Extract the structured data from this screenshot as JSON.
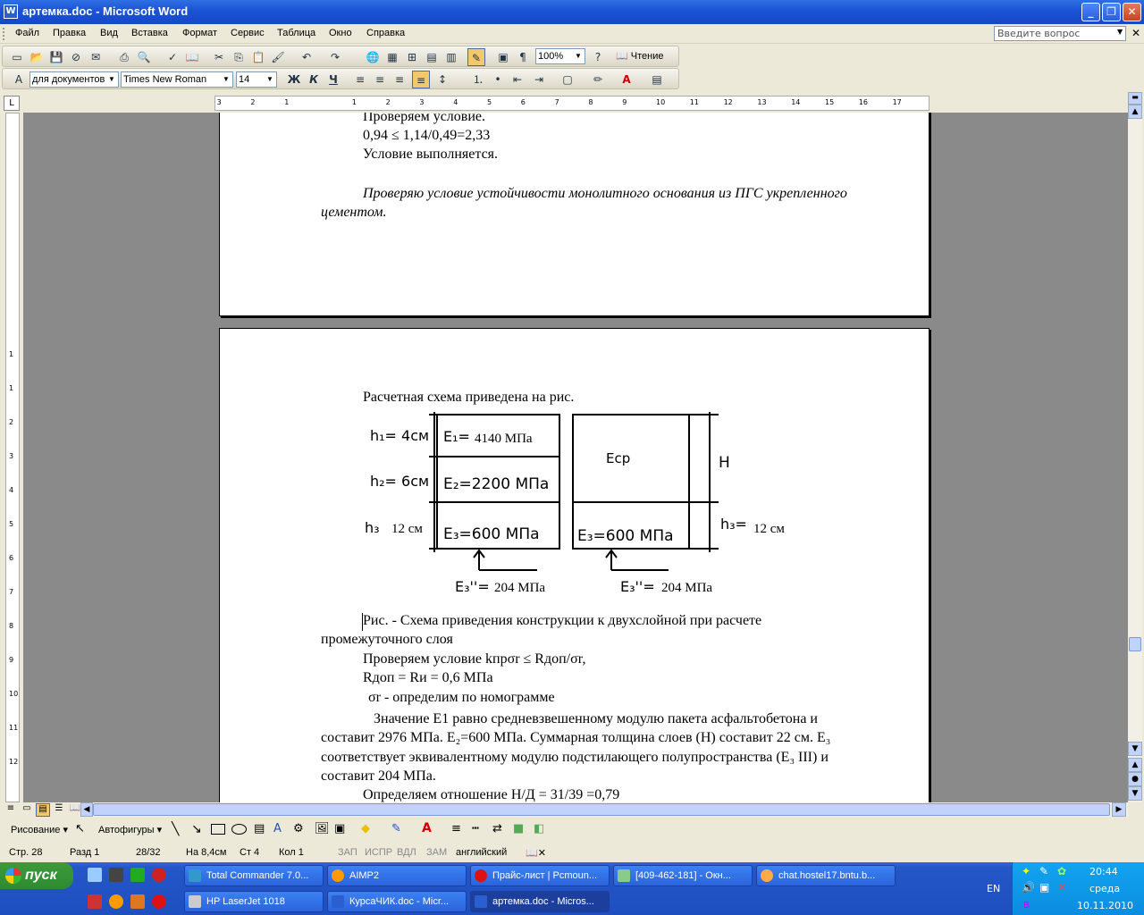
{
  "window": {
    "title": "артемка.doc - Microsoft Word",
    "icon": "W"
  },
  "menu": [
    "Файл",
    "Правка",
    "Вид",
    "Вставка",
    "Формат",
    "Сервис",
    "Таблица",
    "Окно",
    "Справка"
  ],
  "ask_placeholder": "Введите вопрос",
  "toolbar": {
    "zoom": "100%",
    "reading_label": "Чтение",
    "style": "для документов",
    "font": "Times New Roman",
    "size": "14",
    "bold": "Ж",
    "italic": "К",
    "underline": "Ч"
  },
  "ruler": {
    "h_labels": [
      "3",
      "2",
      "1",
      "1",
      "2",
      "3",
      "4",
      "5",
      "6",
      "7",
      "8",
      "9",
      "10",
      "11",
      "12",
      "13",
      "14",
      "15",
      "16",
      "17"
    ],
    "v_labels": [
      "1",
      "1",
      "2",
      "3",
      "4",
      "5",
      "6",
      "7",
      "8",
      "9",
      "10",
      "11",
      "12"
    ]
  },
  "page1": {
    "l1": "Проверяем условие.",
    "l2": "0,94 ≤ 1,14/0,49=2,33",
    "l3": "Условие выполняется.",
    "l4": "Проверяю условие устойчивости монолитного основания из ПГС укрепленного",
    "l5": "цементом."
  },
  "page2": {
    "intro": "Расчетная схема приведена на рис.",
    "fig": {
      "h1": "h₁= 4см",
      "e1": "E₁=",
      "e1v": "4140 МПа",
      "h2": "h₂= 6см",
      "e2": "E₂=2200 МПа",
      "h3": "h₃",
      "h3v": "12 см",
      "e3": "E₃=600 МПа",
      "eb": "E₃''=",
      "ebv": "204 МПа",
      "ecp": "Eср",
      "H": "H",
      "e3r": "E₃=600 МПа",
      "h3r": "h₃=",
      "h3rv": "12 см",
      "ebr": "E₃''=",
      "ebrv": "204 МПа"
    },
    "cap1": "Рис.          - Схема приведения конструкции к двухслойной при расчете",
    "cap2": "промежуточного слоя",
    "c1": "Проверяем условие kпрσr ≤ Rдоп/σr,",
    "c2": "Rдоп = Rи   = 0,6 МПа",
    "c3": "σr - определим по номограмме",
    "p1": "Значение Е1 равно средневзвешенному модулю пакета асфальтобетона и",
    "p2": "составит 2976 МПа. E₂=600 МПа. Суммарная толщина слоев (Н) составит 22 см. Е₃",
    "p3": "соответствует эквивалентному модулю подстилающего полупространства (Е₃ III) и",
    "p4": "составит 204 МПа.",
    "p5": "Определяем отношение Н/Д = 31/39 =0,79"
  },
  "drawbar": {
    "drawing": "Рисование",
    "autoshapes": "Автофигуры"
  },
  "status": {
    "page": "Стр. 28",
    "section": "Разд 1",
    "count": "28/32",
    "at": "На 8,4см",
    "line": "Ст 4",
    "col": "Кол 1",
    "rec": "ЗАП",
    "trk": "ИСПР",
    "ext": "ВДЛ",
    "ovr": "ЗАМ",
    "lang": "английский"
  },
  "taskbar": {
    "start": "пуск",
    "row1": [
      "Total Commander 7.0...",
      "AIMP2",
      "Прайс-лист | Pcmoun...",
      "[409-462-181] - Окн...",
      "chat.hostel17.bntu.b..."
    ],
    "row2": [
      "HP LaserJet 1018",
      "КурсаЧИК.doc - Micr...",
      "артемка.doc - Micros..."
    ],
    "lang": "EN",
    "time": "20:44",
    "day": "среда",
    "date": "10.11.2010"
  }
}
